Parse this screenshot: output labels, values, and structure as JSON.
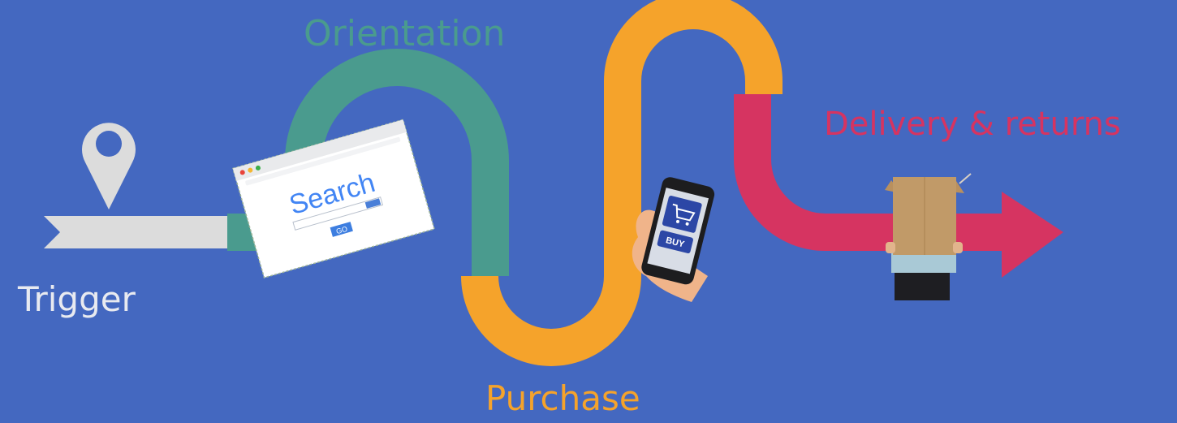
{
  "stages": {
    "trigger": {
      "label": "Trigger",
      "color": "#e0e0e0"
    },
    "orientation": {
      "label": "Orientation",
      "color": "#4a9b8e"
    },
    "purchase": {
      "label": "Purchase",
      "color": "#f5a32b"
    },
    "delivery": {
      "label": "Delivery & returns",
      "color": "#d63461"
    }
  },
  "illustrations": {
    "browser_search_word": "Search",
    "browser_go_button": "GO",
    "phone_buy_button": "BUY"
  },
  "icons": [
    "location-pin-icon",
    "shopping-cart-icon",
    "arrow-right-icon"
  ]
}
